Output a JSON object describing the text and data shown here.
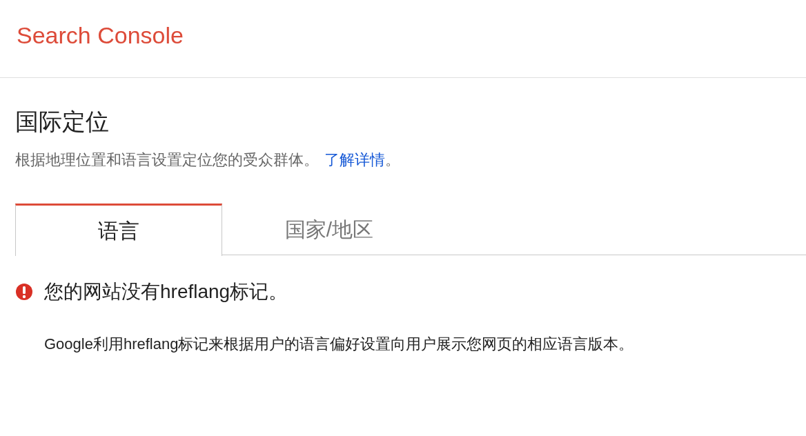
{
  "header": {
    "title": "Search Console"
  },
  "page": {
    "title": "国际定位",
    "description": "根据地理位置和语言设置定位您的受众群体。",
    "link": "了解详情",
    "after_link": "。"
  },
  "tabs": [
    {
      "label": "语言",
      "selected": true
    },
    {
      "label": "国家/地区",
      "selected": false
    }
  ],
  "message": {
    "kind": "error",
    "title": "您的网站没有hreflang标记。",
    "body": "Google利用hreflang标记来根据用户的语言偏好设置向用户展示您网页的相应语言版本。"
  }
}
